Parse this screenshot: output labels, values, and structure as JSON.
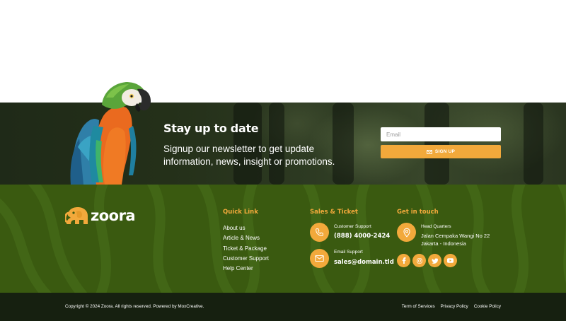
{
  "newsletter": {
    "title": "Stay up to date",
    "description": "Signup our newsletter to get update information, news, insight or promotions.",
    "email_placeholder": "Email",
    "signup_label": "SIGN UP"
  },
  "brand": {
    "name": "zoora",
    "logo_icon": "elephant-icon"
  },
  "quick_link": {
    "title": "Quick Link",
    "items": [
      "About us",
      "Article & News",
      "Ticket & Package",
      "Customer Support",
      "Help Center"
    ]
  },
  "sales": {
    "title": "Sales & Ticket",
    "support_label": "Customer Support",
    "support_phone": "(888) 4000-2424",
    "email_label": "Email Support",
    "email_value": "sales@domain.tld"
  },
  "touch": {
    "title": "Get in touch",
    "hq_label": "Head Quarters",
    "hq_line1": "Jalan Cempaka Wangi No 22",
    "hq_line2": "Jakarta - Indonesia",
    "socials": [
      "facebook-icon",
      "instagram-icon",
      "twitter-icon",
      "youtube-icon"
    ]
  },
  "bottom": {
    "copyright": "Copyright © 2024 Zoora. All rights reserved. Powered by MoxCreative.",
    "links": [
      "Term of Services",
      "Privacy Policy",
      "Cookie Policy"
    ]
  },
  "colors": {
    "accent": "#f2a93b",
    "footer_bg": "#3a5a10",
    "bottom_bg": "#162010"
  }
}
